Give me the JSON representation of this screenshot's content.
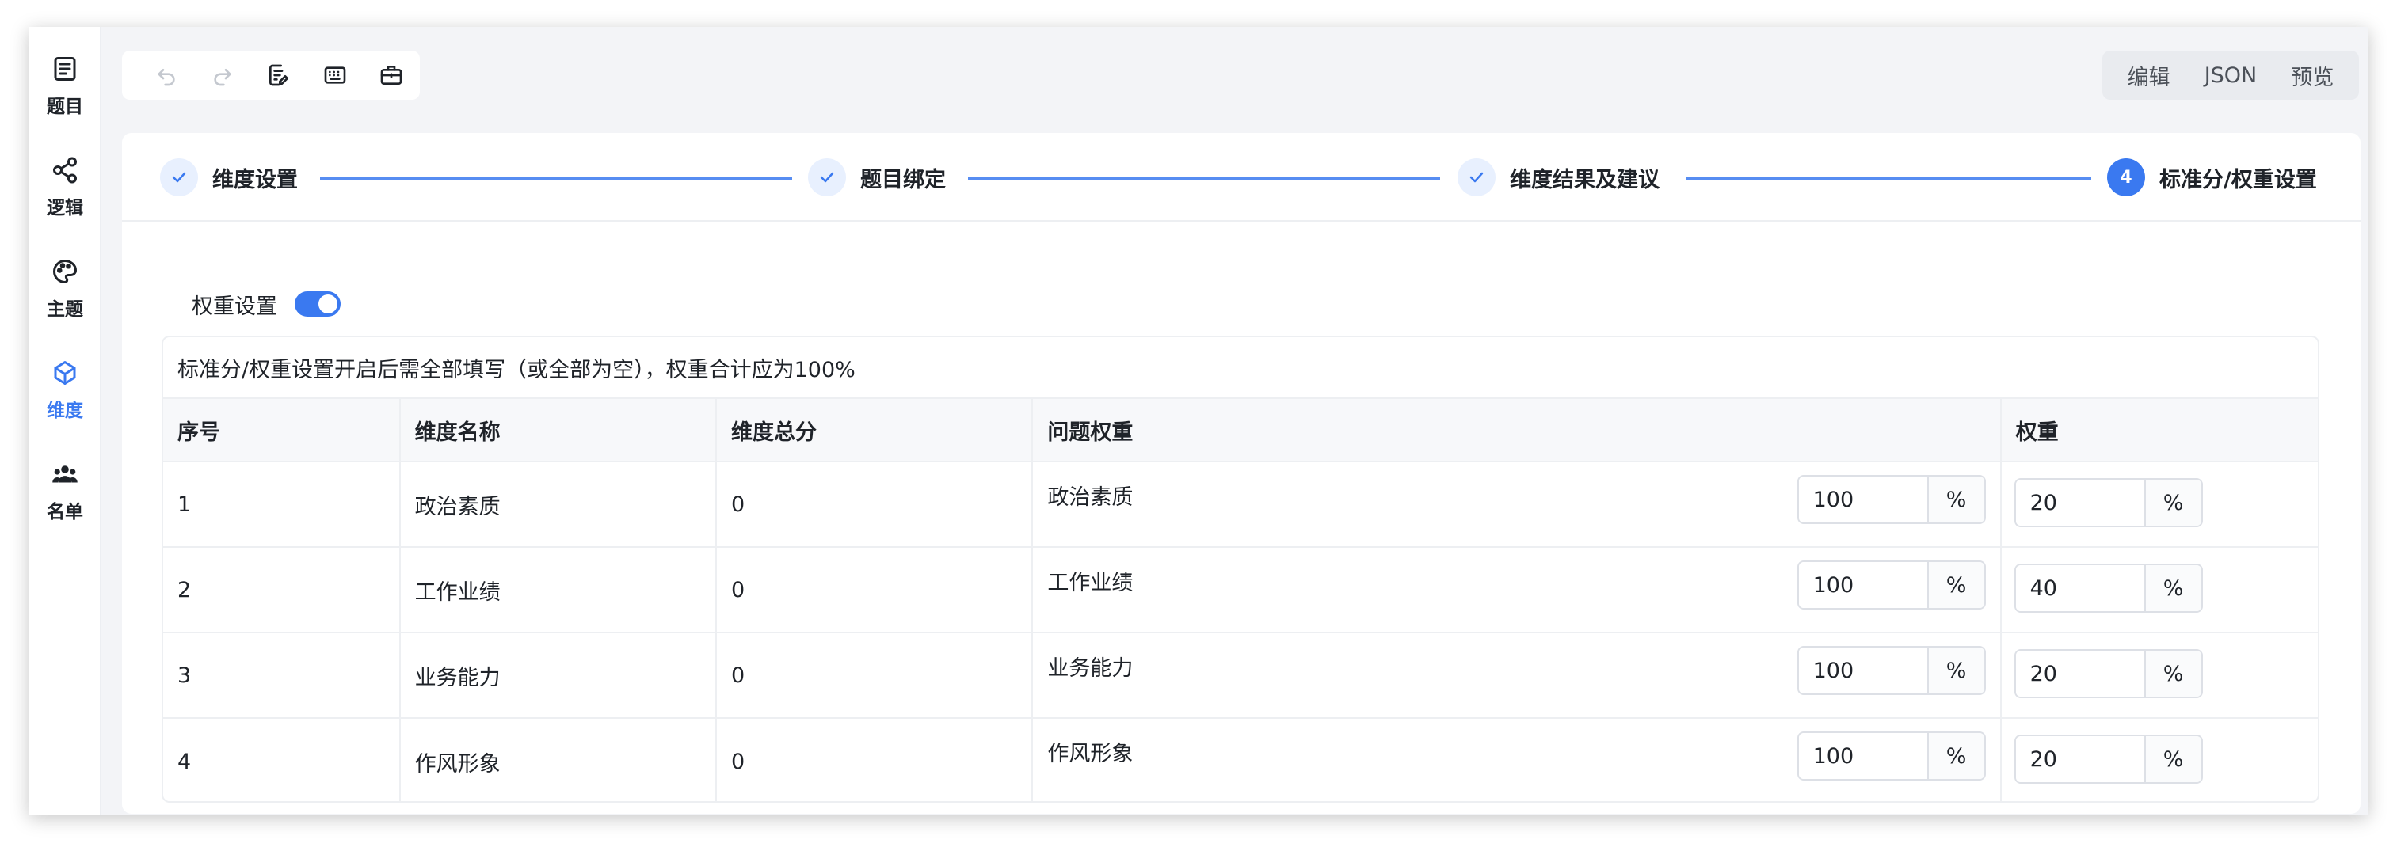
{
  "sidebar": {
    "items": [
      {
        "label": "题目",
        "icon": "document-icon"
      },
      {
        "label": "逻辑",
        "icon": "share-nodes-icon"
      },
      {
        "label": "主题",
        "icon": "palette-icon"
      },
      {
        "label": "维度",
        "icon": "cube-icon",
        "active": true
      },
      {
        "label": "名单",
        "icon": "users-icon"
      }
    ]
  },
  "toolbar": {
    "tools": [
      "undo-icon",
      "redo-icon",
      "edit-document-icon",
      "keyboard-icon",
      "briefcase-icon"
    ]
  },
  "mode_switch": {
    "items": [
      "编辑",
      "JSON",
      "预览"
    ]
  },
  "steps": [
    {
      "title": "维度设置",
      "status": "done"
    },
    {
      "title": "题目绑定",
      "status": "done"
    },
    {
      "title": "维度结果及建议",
      "status": "done"
    },
    {
      "title": "标准分/权重设置",
      "status": "current",
      "number": "4"
    }
  ],
  "weight": {
    "label": "权重设置",
    "enabled": true
  },
  "table": {
    "notice": "标准分/权重设置开启后需全部填写（或全部为空），权重合计应为100%",
    "columns": [
      "序号",
      "维度名称",
      "维度总分",
      "问题权重",
      "权重"
    ],
    "rows": [
      {
        "index": "1",
        "name": "政治素质",
        "total": "0",
        "question": "政治素质",
        "question_weight": "100",
        "unit": "%",
        "weight": "20"
      },
      {
        "index": "2",
        "name": "工作业绩",
        "total": "0",
        "question": "工作业绩",
        "question_weight": "100",
        "unit": "%",
        "weight": "40"
      },
      {
        "index": "3",
        "name": "业务能力",
        "total": "0",
        "question": "业务能力",
        "question_weight": "100",
        "unit": "%",
        "weight": "20"
      },
      {
        "index": "4",
        "name": "作风形象",
        "total": "0",
        "question": "作风形象",
        "question_weight": "100",
        "unit": "%",
        "weight": "20"
      }
    ]
  },
  "colors": {
    "accent": "#3a79f0",
    "background": "#f3f4f7",
    "border": "#edeff2"
  }
}
